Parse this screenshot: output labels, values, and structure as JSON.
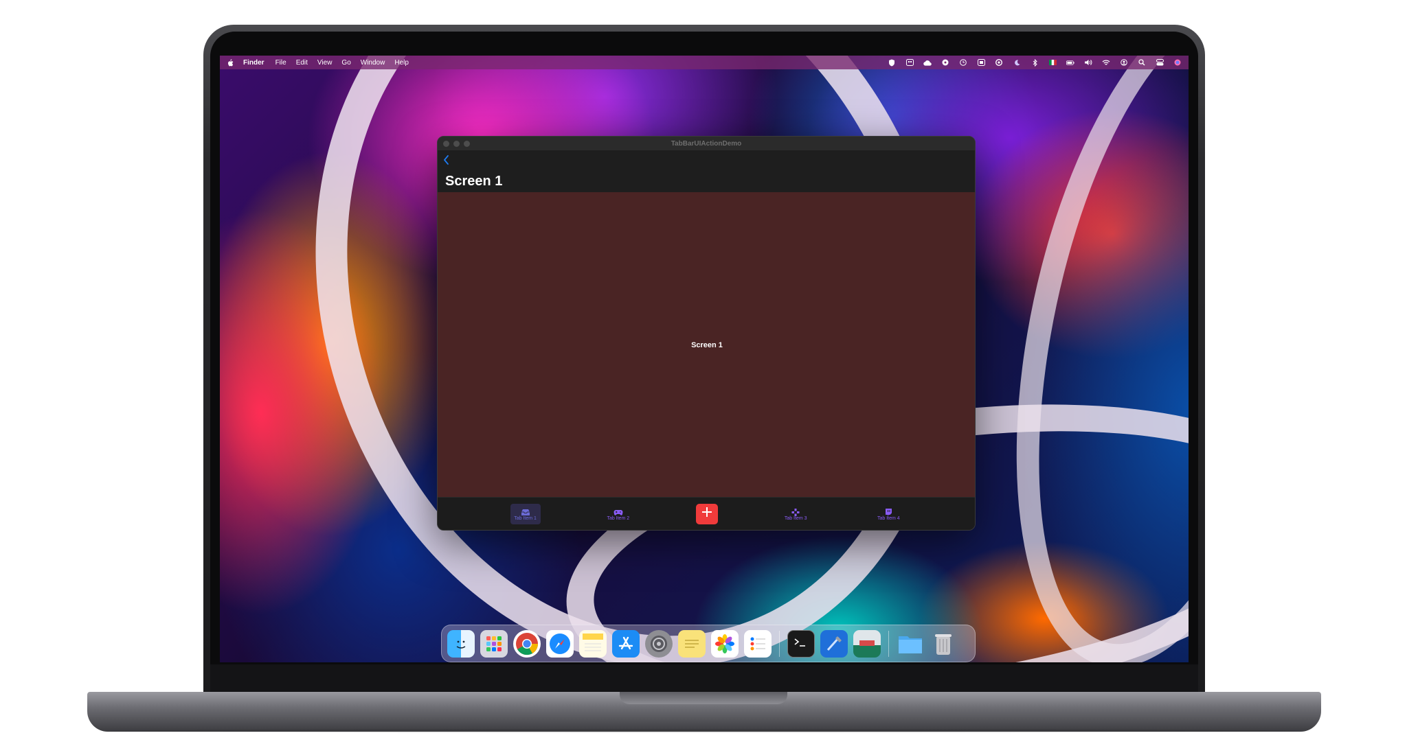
{
  "menubar": {
    "app_name": "Finder",
    "items": [
      "File",
      "Edit",
      "View",
      "Go",
      "Window",
      "Help"
    ],
    "status_icons": [
      "shield-icon",
      "keyboard-icon",
      "cloud-upload-icon",
      "fan-icon",
      "clock-icon",
      "display-icon",
      "lock-icon",
      "moon-icon",
      "bluetooth-icon",
      "flag-icon",
      "battery-icon",
      "volume-icon",
      "wifi-icon",
      "user-icon",
      "spotlight-icon",
      "control-center-icon",
      "siri-icon"
    ]
  },
  "window": {
    "title": "TabBarUIActionDemo",
    "nav_title": "Screen 1",
    "content_label": "Screen 1",
    "tabs": [
      {
        "label": "Tab Item 1",
        "icon": "tray-icon",
        "active": true
      },
      {
        "label": "Tab Item 2",
        "icon": "gamecontroller-icon",
        "active": false
      },
      {
        "label": "Tab Item 3",
        "icon": "dpad-icon",
        "active": false
      },
      {
        "label": "Tab Item 4",
        "icon": "twitch-icon",
        "active": false
      }
    ],
    "action_button_icon": "plus-icon",
    "colors": {
      "content_bg": "#4a2424",
      "tab_tint": "#8a5cf6",
      "action": "#f03b3b"
    }
  },
  "dock": {
    "apps": [
      "finder-icon",
      "launchpad-icon",
      "chrome-icon",
      "safari-icon",
      "notes-icon",
      "app-store-icon",
      "system-preferences-icon",
      "stickies-icon",
      "photos-icon",
      "reminders-icon",
      "terminal-icon",
      "xcode-icon",
      "simulator-icon",
      "downloads-folder-icon",
      "trash-icon"
    ]
  }
}
